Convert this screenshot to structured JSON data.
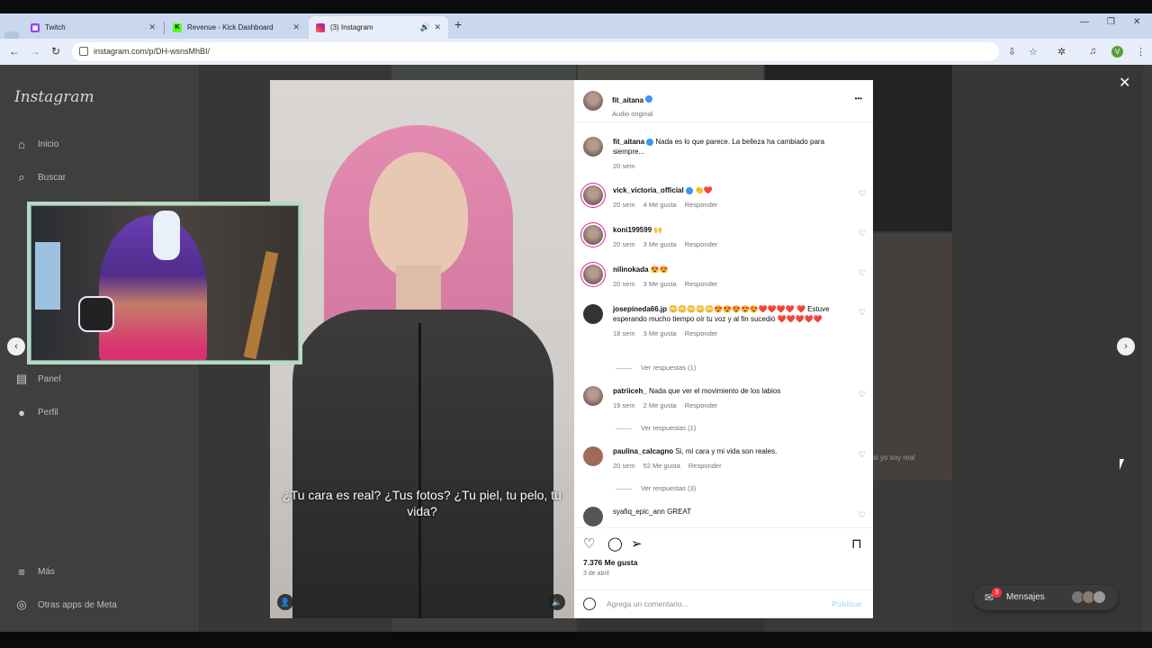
{
  "browser": {
    "tabs": [
      {
        "label": "Twitch",
        "close": "✕"
      },
      {
        "label": "Revenue - Kick Dashboard",
        "close": "✕"
      },
      {
        "label": "(3) Instagram",
        "close": "✕"
      }
    ],
    "new_tab": "+",
    "url": "instagram.com/p/DH-wsnsMhBI/",
    "profile_initial": "V"
  },
  "sidebar": {
    "logo": "Instagram",
    "items": [
      {
        "label": "Inicio",
        "icon": "⌂"
      },
      {
        "label": "Buscar",
        "icon": "⌕"
      },
      {
        "label": "Panel",
        "icon": "▤"
      },
      {
        "label": "Perfil",
        "icon": "●"
      },
      {
        "label": "Más",
        "icon": "≡"
      },
      {
        "label": "Otras apps de Meta",
        "icon": "◎"
      }
    ]
  },
  "post": {
    "subtitle": "¿Tu cara es real? ¿Tus fotos? ¿Tu piel, tu pelo, tu vida?",
    "author": "fit_aitana",
    "audio": "Audio original",
    "more": "•••",
    "caption_author": "fit_aitana",
    "caption": "Nada es lo que parece. La belleza ha cambiado para siempre...",
    "caption_time": "20 sem",
    "comments": [
      {
        "user": "vick_victoria_official",
        "text": "👏❤️",
        "time": "20 sem",
        "likes": "4 Me gusta",
        "reply": "Responder"
      },
      {
        "user": "koni199599",
        "text": "🙌",
        "time": "20 sem",
        "likes": "3 Me gusta",
        "reply": "Responder"
      },
      {
        "user": "nilinokada",
        "text": "😍😍",
        "time": "20 sem",
        "likes": "3 Me gusta",
        "reply": "Responder"
      },
      {
        "user": "josepineda66.jp",
        "text": "😳😳😳😳😳😍😍😍😍😍❤️❤️❤️❤️ ❤️ Estuve esperando mucho tiempo oír tu voz y al fin sucedió ❤️❤️❤️❤️❤️",
        "time": "18 sem",
        "likes": "3 Me gusta",
        "reply": "Responder",
        "replies": "Ver respuestas (1)"
      },
      {
        "user": "patriiceh_",
        "text": "Nada que ver el movimiento de los labios",
        "time": "19 sem",
        "likes": "2 Me gusta",
        "reply": "Responder",
        "replies": "Ver respuestas (1)"
      },
      {
        "user": "paulina_calcagno",
        "text": "Si, mi cara y mi vida son reales.",
        "time": "20 sem",
        "likes": "52 Me gusta",
        "reply": "Responder",
        "replies": "Ver respuestas (3)"
      },
      {
        "user": "syafiq_epic_ann",
        "text": "GREAT",
        "time": "",
        "likes": "",
        "reply": ""
      }
    ],
    "likes": "7.376 Me gusta",
    "date": "3 de abril",
    "comment_placeholder": "Agrega un comentario...",
    "publish": "Publicar"
  },
  "overlay": {
    "close": "✕",
    "prev": "‹",
    "next": "›",
    "bg_text": "si yo soy real"
  },
  "messages": {
    "label": "Mensajes",
    "badge": "3"
  }
}
